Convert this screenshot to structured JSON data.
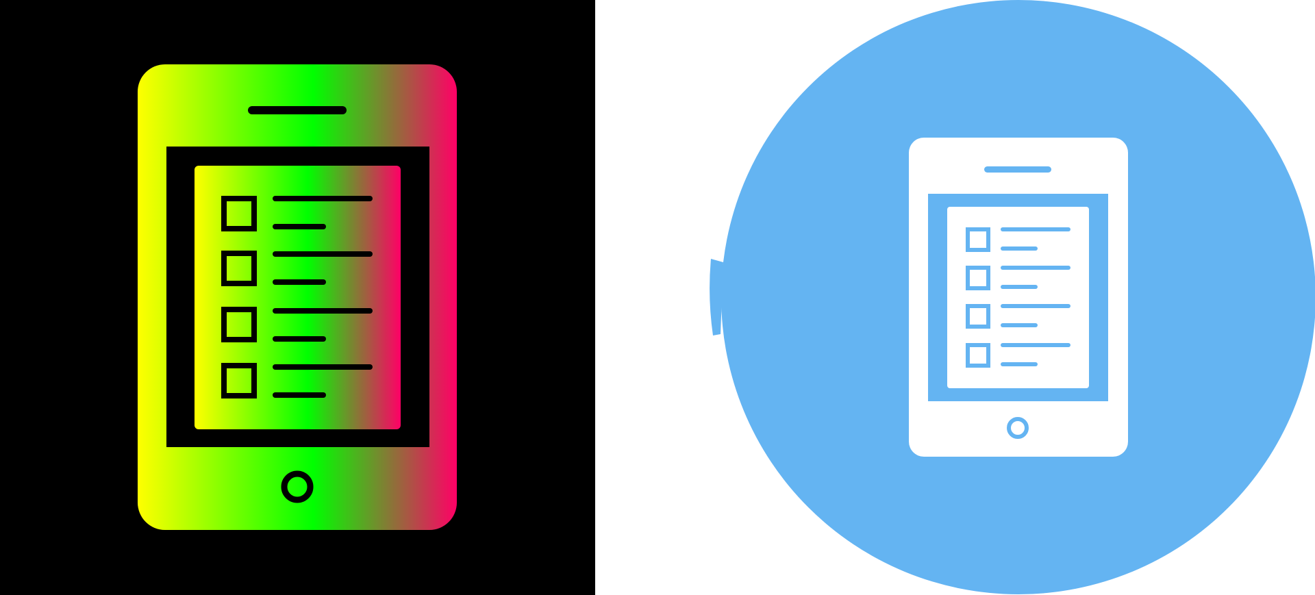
{
  "variants": [
    {
      "name": "gradient-glyph",
      "background": "#000000",
      "gradient": [
        "#ffff00",
        "#00ff00",
        "#ff0066"
      ],
      "stroke": "#000000",
      "checklist_rows": 4
    },
    {
      "name": "flat-circle",
      "background": "#ffffff",
      "circle": "#64b4f2",
      "device": "#ffffff",
      "accent": "#64b4f2",
      "checklist_rows": 4
    }
  ]
}
